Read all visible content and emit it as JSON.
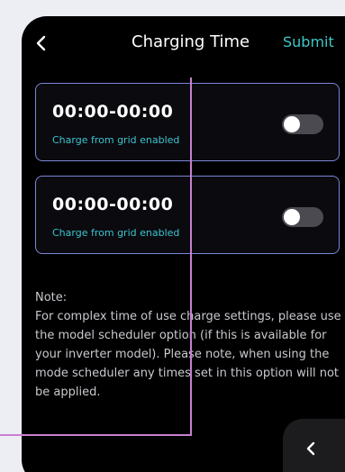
{
  "header": {
    "title": "Charging Time",
    "submit_label": "Submit",
    "back_icon": "chevron-left-icon"
  },
  "slots": [
    {
      "time": "00:00-00:00",
      "label": "Charge from grid enabled",
      "enabled": false
    },
    {
      "time": "00:00-00:00",
      "label": "Charge from grid enabled",
      "enabled": false
    }
  ],
  "note": {
    "heading": "Note:",
    "body": "For complex time of use charge settings, please use the model scheduler option (if this is available for your inverter model). Please note, when using the mode scheduler any times set in this option will not be applied."
  },
  "colors": {
    "accent": "#3fc6c6",
    "card_border": "#7b86d9",
    "annotation_line": "#c97fd0"
  },
  "corner_icon": "chevron-left-icon"
}
